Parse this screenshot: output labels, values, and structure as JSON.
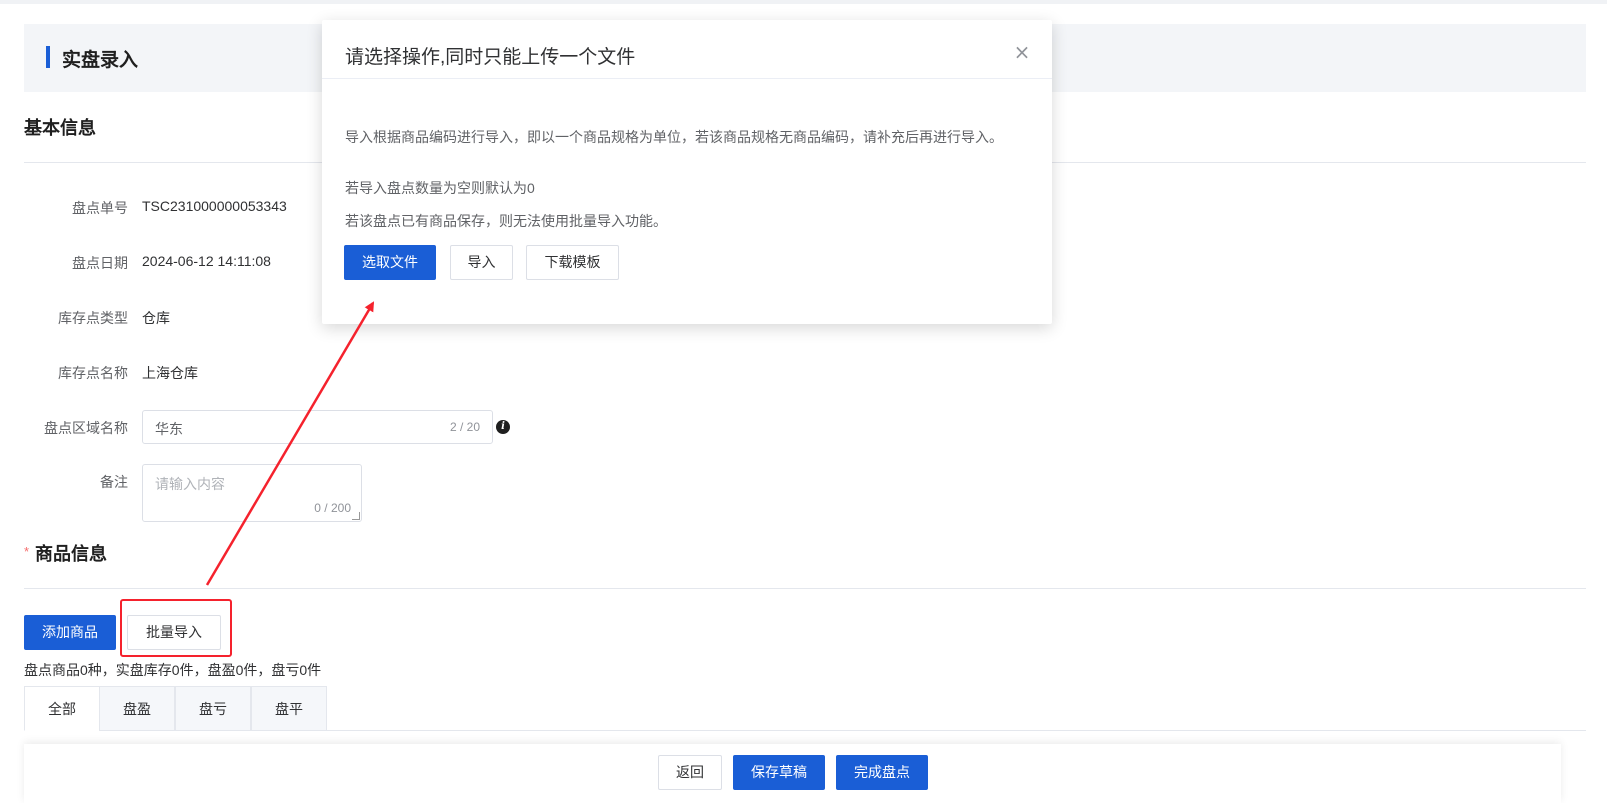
{
  "header": {
    "title": "实盘录入"
  },
  "basic_info": {
    "section_title": "基本信息",
    "fields": [
      {
        "label": "盘点单号",
        "value": "TSC231000000053343"
      },
      {
        "label": "盘点日期",
        "value": "2024-06-12 14:11:08"
      },
      {
        "label": "库存点类型",
        "value": "仓库"
      },
      {
        "label": "库存点名称",
        "value": "上海仓库"
      }
    ],
    "region": {
      "label": "盘点区域名称",
      "value": "华东",
      "count": "2 / 20"
    },
    "remark": {
      "label": "备注",
      "placeholder": "请输入内容",
      "count": "0 / 200"
    }
  },
  "goods_info": {
    "required_mark": "*",
    "section_title": "商品信息",
    "add_button": "添加商品",
    "batch_import_button": "批量导入",
    "summary": "盘点商品0种，实盘库存0件，盘盈0件，盘亏0件",
    "tabs": [
      "全部",
      "盘盈",
      "盘亏",
      "盘平"
    ],
    "active_tab": 0
  },
  "footer": {
    "back": "返回",
    "save_draft": "保存草稿",
    "complete": "完成盘点"
  },
  "modal": {
    "title": "请选择操作,同时只能上传一个文件",
    "close": "×",
    "lines": [
      "导入根据商品编码进行导入，即以一个商品规格为单位，若该商品规格无商品编码，请补充后再进行导入。",
      "若导入盘点数量为空则默认为0",
      "若该盘点已有商品保存，则无法使用批量导入功能。"
    ],
    "select_file": "选取文件",
    "import": "导入",
    "download_template": "下载模板"
  },
  "colors": {
    "primary": "#1a5ed6",
    "annotation": "#f5222d"
  }
}
